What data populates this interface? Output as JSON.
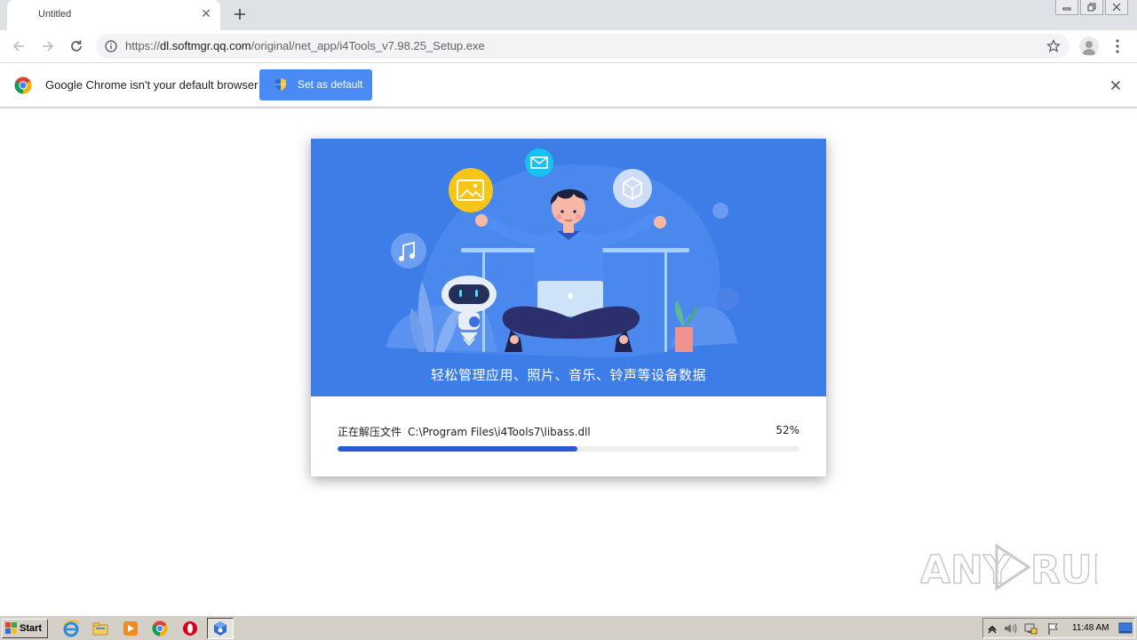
{
  "browser": {
    "tab": {
      "title": "Untitled",
      "close_glyph": "✕",
      "new_tab_icon": "plus-icon"
    },
    "address": {
      "scheme": "https://",
      "host": "dl.softmgr.qq.com",
      "path": "/original/net_app/i4Tools_v7.98.25_Setup.exe"
    },
    "nav_icons": [
      "back-arrow-icon",
      "forward-arrow-icon",
      "reload-icon"
    ],
    "window_icons": [
      "minimize-icon",
      "restore-icon",
      "close-icon"
    ]
  },
  "infobar": {
    "message": "Google Chrome isn't your default browser",
    "button_label": "Set as default"
  },
  "installer": {
    "tagline": "轻松管理应用、照片、音乐、铃声等设备数据",
    "status_label": "正在解压文件",
    "status_path": "C:\\Program Files\\i4Tools7\\libass.dll",
    "percent_label": "52%",
    "progress": 52,
    "colors": {
      "banner": "#3d7de8",
      "progress_fill": "#2a59d6"
    }
  },
  "watermark": {
    "text": "ANY RUN"
  },
  "taskbar": {
    "start_label": "Start",
    "clock": "11:48 AM",
    "pinned": [
      "ie-icon",
      "explorer-icon",
      "media-player-icon",
      "chrome-icon",
      "opera-icon",
      "i4tools-icon"
    ]
  }
}
